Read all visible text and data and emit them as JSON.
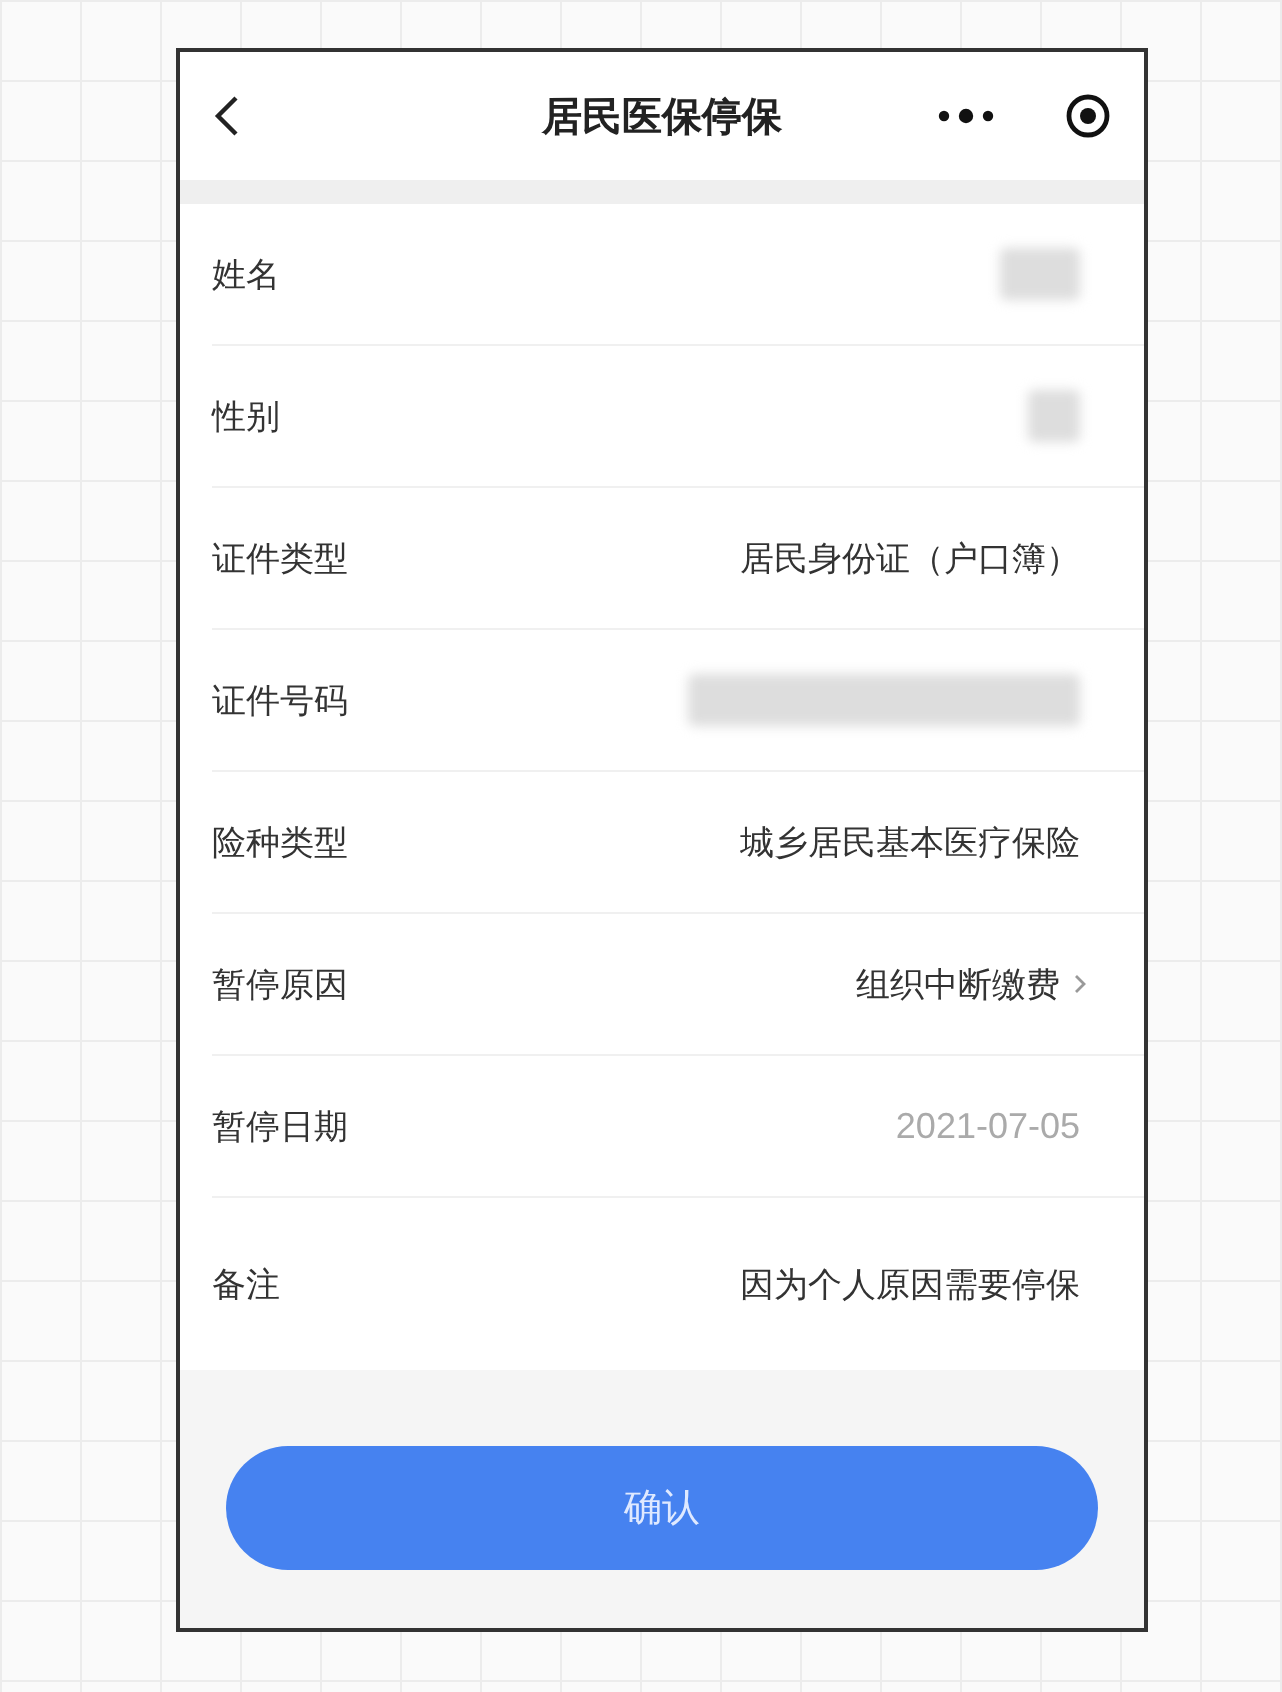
{
  "header": {
    "title": "居民医保停保"
  },
  "fields": [
    {
      "label": "姓名",
      "kind": "redacted"
    },
    {
      "label": "性别",
      "kind": "redacted"
    },
    {
      "label": "证件类型",
      "kind": "text",
      "value": "居民身份证（户口簿）"
    },
    {
      "label": "证件号码",
      "kind": "redacted"
    },
    {
      "label": "险种类型",
      "kind": "text",
      "value": "城乡居民基本医疗保险"
    },
    {
      "label": "暂停原因",
      "kind": "select",
      "value": "组织中断缴费"
    },
    {
      "label": "暂停日期",
      "kind": "date",
      "value": "2021-07-05"
    },
    {
      "label": "备注",
      "kind": "text",
      "value": "因为个人原因需要停保"
    }
  ],
  "confirm_button": "确认"
}
